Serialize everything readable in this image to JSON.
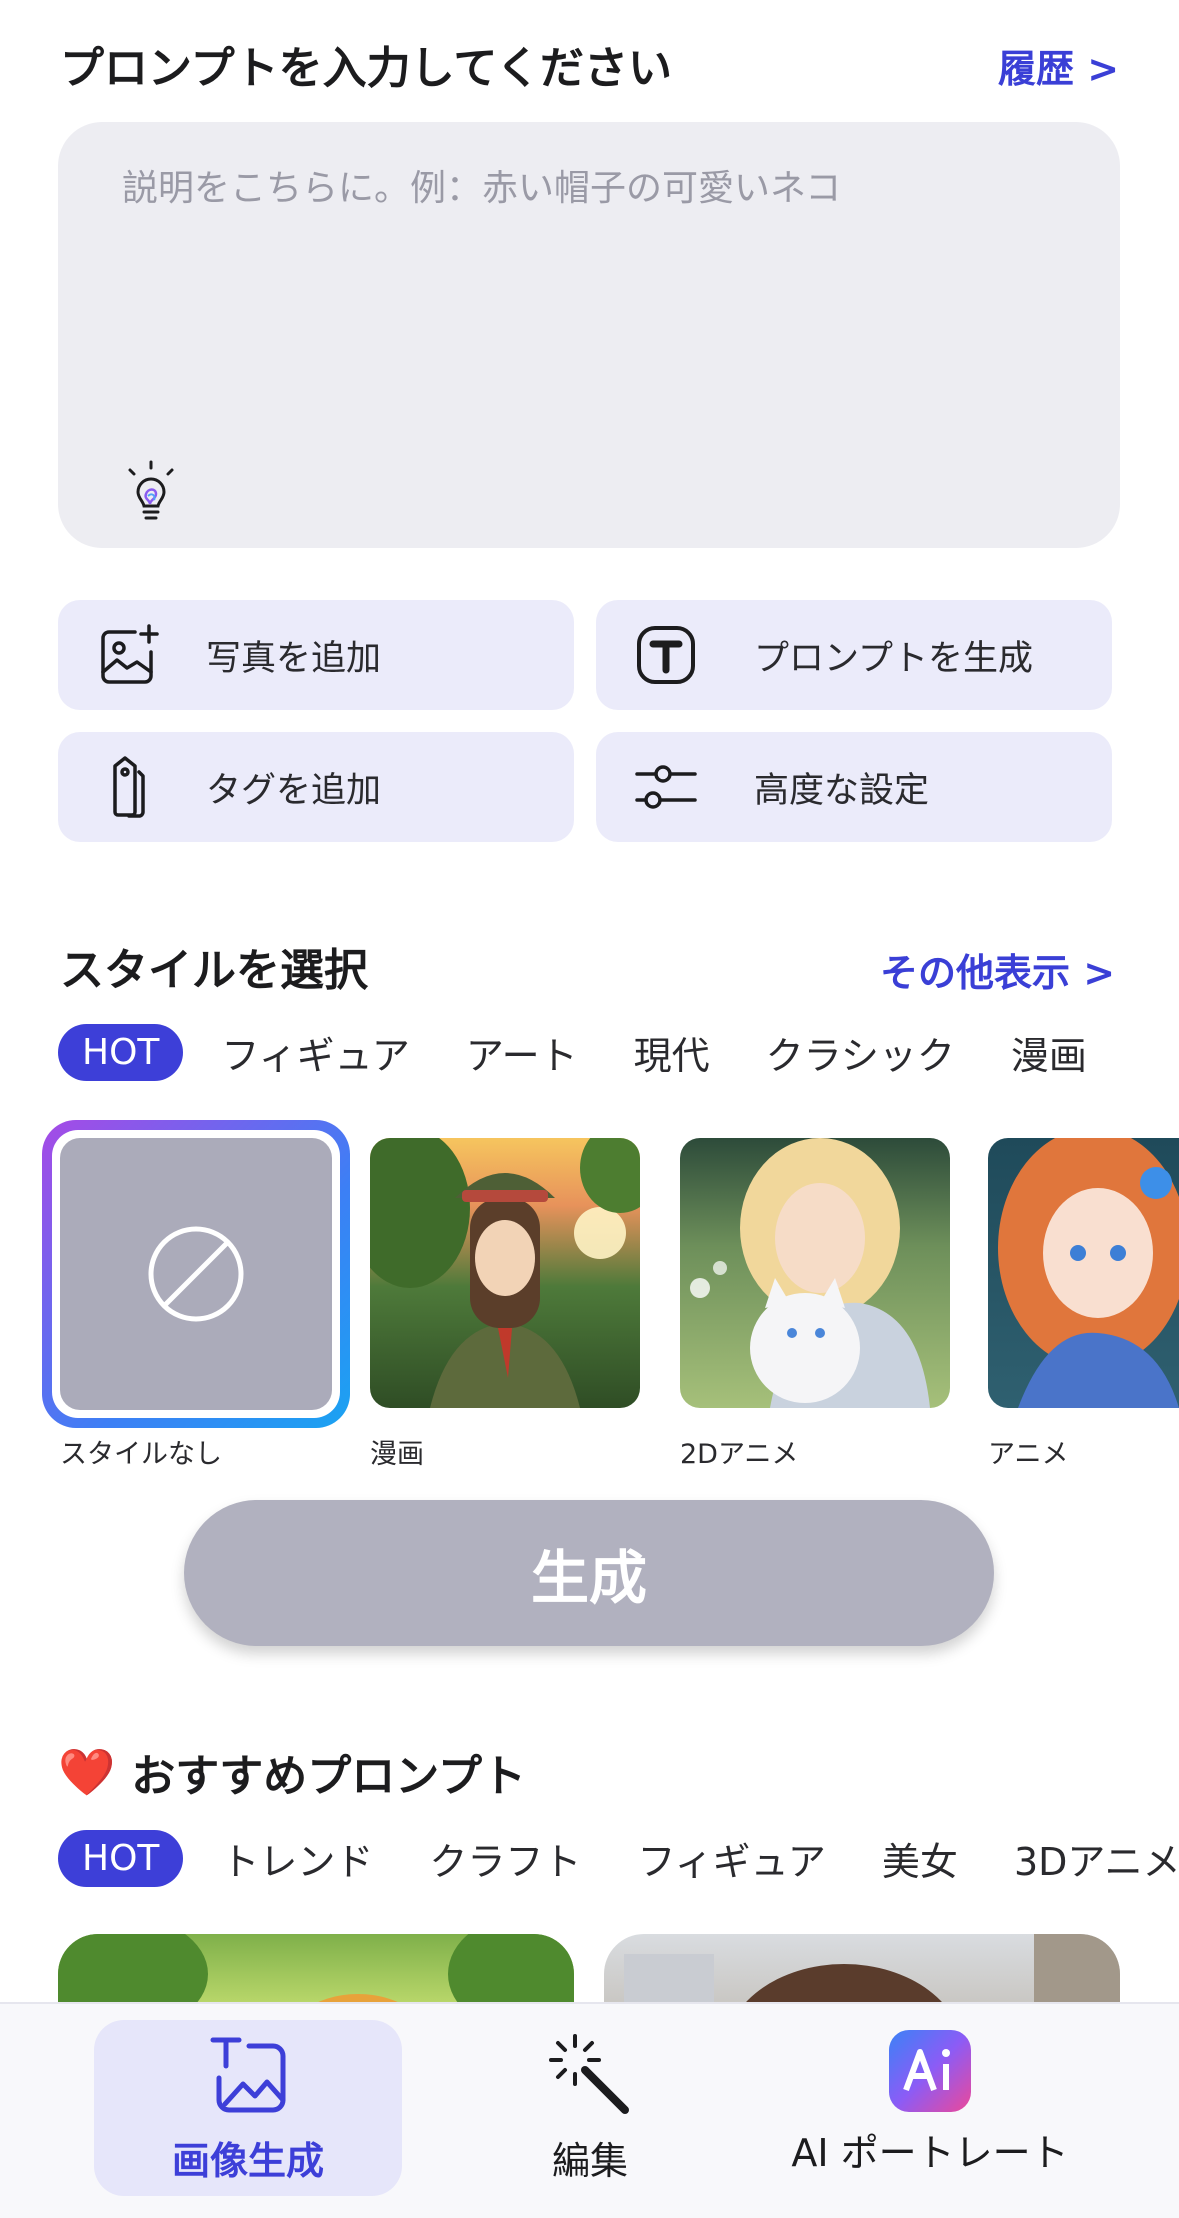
{
  "header": {
    "title": "プロンプトを入力してください",
    "history_link": "履歴 >"
  },
  "prompt": {
    "placeholder": "説明をこちらに。例：赤い帽子の可愛いネコ",
    "value": "",
    "icon": "lightbulb-icon"
  },
  "actions": [
    {
      "label": "写真を追加",
      "icon": "add-photo-icon"
    },
    {
      "label": "プロンプトを生成",
      "icon": "text-t-icon"
    },
    {
      "label": "タグを追加",
      "icon": "tag-icon"
    },
    {
      "label": "高度な設定",
      "icon": "sliders-icon"
    }
  ],
  "style_section": {
    "title": "スタイルを選択",
    "more_link": "その他表示 >",
    "tabs": [
      "HOT",
      "フィギュア",
      "アート",
      "現代",
      "クラシック",
      "漫画"
    ],
    "styles": [
      {
        "label": "スタイルなし",
        "selected": true
      },
      {
        "label": "漫画",
        "selected": false
      },
      {
        "label": "2Dアニメ",
        "selected": false
      },
      {
        "label": "アニメ",
        "selected": false
      }
    ]
  },
  "generate_button": "生成",
  "recommend_section": {
    "heart": "❤️",
    "title": "おすすめプロンプト",
    "tabs": [
      "HOT",
      "トレンド",
      "クラフト",
      "フィギュア",
      "美女",
      "3Dアニメ"
    ]
  },
  "bottom_nav": [
    {
      "label": "画像生成",
      "icon": "image-generate-icon",
      "active": true
    },
    {
      "label": "編集",
      "icon": "magic-wand-icon",
      "active": false
    },
    {
      "label": "AI ポートレート",
      "icon": "ai-portrait-icon",
      "active": false
    }
  ],
  "colors": {
    "accent": "#3d3fd8",
    "action_bg": "#ebebfa",
    "prompt_bg": "#ededf2",
    "button_disabled": "#b1b1bf"
  }
}
